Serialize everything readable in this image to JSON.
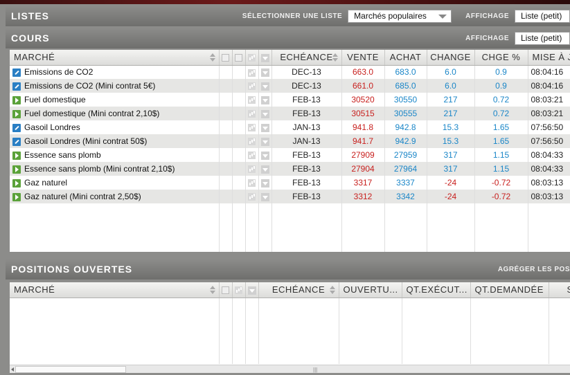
{
  "lists_bar": {
    "title": "LISTES",
    "select_label": "SÉLECTIONNER UNE LISTE",
    "select_value": "Marchés populaires",
    "display_label": "AFFICHAGE",
    "display_value": "Liste (petit)"
  },
  "prices_bar": {
    "title": "COURS",
    "display_label": "AFFICHAGE",
    "display_value": "Liste (petit)"
  },
  "prices_table": {
    "headers": {
      "market": "MARCHÉ",
      "expiry": "ECHÉANCE",
      "sell": "VENTE",
      "buy": "ACHAT",
      "change": "CHANGE",
      "change_pct": "CHGE %",
      "updated": "MISE À JO"
    },
    "rows": [
      {
        "icon": "pencil-icon",
        "name": "Emissions de CO2",
        "expiry": "DEC-13",
        "sell": "663.0",
        "buy": "683.0",
        "change": "6.0",
        "pct": "0.9",
        "time": "08:04:16",
        "neg": false
      },
      {
        "icon": "pencil-icon",
        "name": "Emissions de CO2 (Mini contrat 5€)",
        "expiry": "DEC-13",
        "sell": "661.0",
        "buy": "685.0",
        "change": "6.0",
        "pct": "0.9",
        "time": "08:04:16",
        "neg": false
      },
      {
        "icon": "play-icon",
        "name": "Fuel domestique",
        "expiry": "FEB-13",
        "sell": "30520",
        "buy": "30550",
        "change": "217",
        "pct": "0.72",
        "time": "08:03:21",
        "neg": false
      },
      {
        "icon": "play-icon",
        "name": "Fuel domestique (Mini contrat 2,10$)",
        "expiry": "FEB-13",
        "sell": "30515",
        "buy": "30555",
        "change": "217",
        "pct": "0.72",
        "time": "08:03:21",
        "neg": false
      },
      {
        "icon": "pencil-icon",
        "name": "Gasoil Londres",
        "expiry": "JAN-13",
        "sell": "941.8",
        "buy": "942.8",
        "change": "15.3",
        "pct": "1.65",
        "time": "07:56:50",
        "neg": false
      },
      {
        "icon": "pencil-icon",
        "name": "Gasoil Londres (Mini contrat 50$)",
        "expiry": "JAN-13",
        "sell": "941.7",
        "buy": "942.9",
        "change": "15.3",
        "pct": "1.65",
        "time": "07:56:50",
        "neg": false
      },
      {
        "icon": "play-icon",
        "name": "Essence sans plomb",
        "expiry": "FEB-13",
        "sell": "27909",
        "buy": "27959",
        "change": "317",
        "pct": "1.15",
        "time": "08:04:33",
        "neg": false
      },
      {
        "icon": "play-icon",
        "name": "Essence sans plomb (Mini contrat 2,10$)",
        "expiry": "FEB-13",
        "sell": "27904",
        "buy": "27964",
        "change": "317",
        "pct": "1.15",
        "time": "08:04:33",
        "neg": false
      },
      {
        "icon": "play-icon",
        "name": "Gaz naturel",
        "expiry": "FEB-13",
        "sell": "3317",
        "buy": "3337",
        "change": "-24",
        "pct": "-0.72",
        "time": "08:03:13",
        "neg": true
      },
      {
        "icon": "play-icon",
        "name": "Gaz naturel (Mini contrat 2,50$)",
        "expiry": "FEB-13",
        "sell": "3312",
        "buy": "3342",
        "change": "-24",
        "pct": "-0.72",
        "time": "08:03:13",
        "neg": true
      }
    ]
  },
  "positions_bar": {
    "title": "POSITIONS OUVERTES",
    "aggregate_label": "AGRÉGER LES POS"
  },
  "positions_table": {
    "headers": {
      "market": "MARCHÉ",
      "expiry": "ECHÉANCE",
      "opening": "OUVERTU...",
      "qty_executed": "QT.EXÉCUT...",
      "qty_requested": "QT.DEMANDÉE",
      "stop": "STOP"
    }
  },
  "colors": {
    "sell": "#c8201e",
    "buy": "#1a86c8",
    "positive": "#1a86c8",
    "negative": "#c8201e"
  }
}
